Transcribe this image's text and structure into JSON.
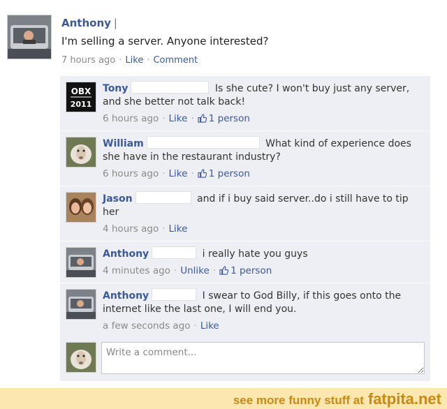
{
  "post": {
    "author": "Anthony",
    "text": "I'm selling a server. Anyone interested?",
    "time": "7 hours ago",
    "like_label": "Like",
    "comment_label": "Comment"
  },
  "comments": [
    {
      "author": "Tony",
      "text": "Is she cute? I won't buy just any server, and she better not talk back!",
      "time": "6 hours ago",
      "like_label": "Like",
      "likes": "1 person",
      "avatar_badge": [
        "OBX",
        "2011"
      ]
    },
    {
      "author": "William",
      "text": "What kind of experience does she have in the restaurant industry?",
      "time": "6 hours ago",
      "like_label": "Like",
      "likes": "1 person"
    },
    {
      "author": "Jason",
      "text": "and if i buy said server..do i still have to tip her",
      "time": "4 hours ago",
      "like_label": "Like"
    },
    {
      "author": "Anthony",
      "text": "i really hate you guys",
      "time": "4 minutes ago",
      "like_label": "Unlike",
      "likes": "1 person"
    },
    {
      "author": "Anthony",
      "text": "I swear to God Billy, if this goes onto the internet like the last one, I will end you.",
      "time": "a few seconds ago",
      "like_label": "Like"
    }
  ],
  "write_comment": {
    "placeholder": "Write a comment..."
  },
  "footer": {
    "text": "see more funny stuff at",
    "site": "fatpita.net"
  },
  "colors": {
    "link": "#3b5998",
    "comment_bg": "#edeff4",
    "footer_bg": "#fde7b0",
    "footer_text": "#c98a14"
  }
}
